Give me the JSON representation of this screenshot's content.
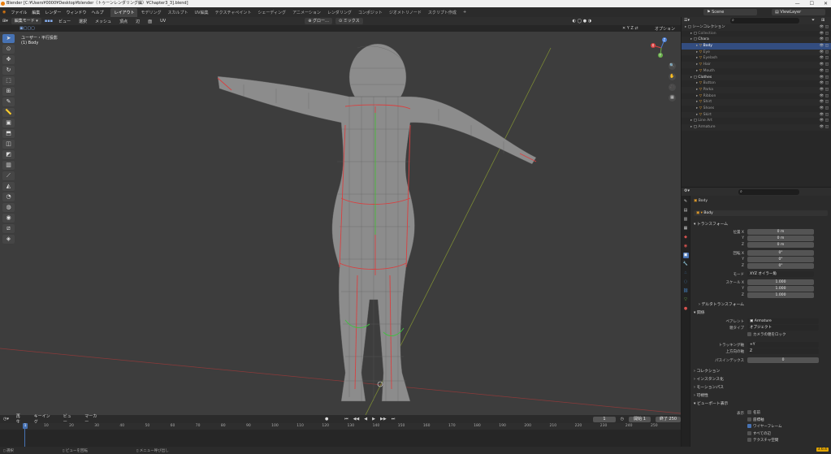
{
  "window": {
    "title": "Blender [C:¥Users¥0000¥Desktop¥blender（トゥーンレンダリング編）¥Chapter3_3].blend]",
    "controls": [
      "—",
      "☐",
      "✕"
    ]
  },
  "menubar": {
    "menus": [
      "ファイル",
      "編集",
      "レンダー",
      "ウィンドウ",
      "ヘルプ"
    ],
    "workspaces": [
      "レイアウト",
      "モデリング",
      "スカルプト",
      "UV編集",
      "テクスチャペイント",
      "シェーディング",
      "アニメーション",
      "レンダリング",
      "コンポジット",
      "ジオメトリノード",
      "スクリプト作成"
    ],
    "active_workspace": "レイアウト",
    "add_tab": "+",
    "scene": "Scene",
    "view_layer": "ViewLayer"
  },
  "viewport_header": {
    "mode": "編集モード",
    "menus": [
      "ビュー",
      "選択",
      "メッシュ",
      "頂点",
      "辺",
      "面",
      "UV"
    ],
    "transform_orientation": "グロー…",
    "snap_mode": "ミックス",
    "options": "オプション"
  },
  "viewport": {
    "view_name": "ユーザー・平行投影",
    "object_name": "(1) Body",
    "tools": [
      "select",
      "cursor",
      "move",
      "rotate",
      "scale",
      "transform",
      "annotate",
      "measure",
      "add-cube",
      "extrude",
      "inset",
      "bevel",
      "loop-cut",
      "knife",
      "poly-build",
      "spin",
      "smooth",
      "shrink",
      "shear",
      "rip"
    ],
    "nav_buttons": [
      "🔍",
      "✋",
      "🎥",
      "▦"
    ],
    "gizmo_axes": [
      "X",
      "Y",
      "Z"
    ]
  },
  "timeline": {
    "menus": [
      "再生",
      "キーイング",
      "ビュー",
      "マーカー"
    ],
    "current_frame": "1",
    "start_label": "開始",
    "start": "1",
    "end_label": "終了",
    "end": "250",
    "ticks": [
      "1",
      "10",
      "20",
      "30",
      "40",
      "50",
      "60",
      "70",
      "80",
      "90",
      "100",
      "110",
      "120",
      "130",
      "140",
      "150",
      "160",
      "170",
      "180",
      "190",
      "200",
      "210",
      "220",
      "230",
      "240",
      "250"
    ],
    "transport": [
      "⏮",
      "◀◀",
      "◀",
      "▶",
      "▶▶",
      "⏭"
    ]
  },
  "statusbar": {
    "items": [
      "選択",
      "ビューを回転",
      "メニュー呼び出し"
    ],
    "version": "3.6.4"
  },
  "outliner": {
    "rows": [
      {
        "label": "シーンコレクション",
        "indent": 0,
        "color": "#cfcfcf"
      },
      {
        "label": "Collection",
        "indent": 1,
        "color": "#8a8a8a"
      },
      {
        "label": "Chara",
        "indent": 1,
        "color": "#e0e0e0"
      },
      {
        "label": "Body",
        "indent": 2,
        "color": "#ffffff",
        "selected": true
      },
      {
        "label": "Eye",
        "indent": 2,
        "color": "#9a9a9a"
      },
      {
        "label": "Eyelash",
        "indent": 2,
        "color": "#9a9a9a"
      },
      {
        "label": "Hair",
        "indent": 2,
        "color": "#9a9a9a"
      },
      {
        "label": "Mouth",
        "indent": 2,
        "color": "#9a9a9a"
      },
      {
        "label": "Clothes",
        "indent": 1,
        "color": "#e0e0e0"
      },
      {
        "label": "Button",
        "indent": 2,
        "color": "#9a9a9a"
      },
      {
        "label": "Parka",
        "indent": 2,
        "color": "#9a9a9a"
      },
      {
        "label": "Ribbon",
        "indent": 2,
        "color": "#9a9a9a"
      },
      {
        "label": "Shirt",
        "indent": 2,
        "color": "#9a9a9a"
      },
      {
        "label": "Shoes",
        "indent": 2,
        "color": "#9a9a9a"
      },
      {
        "label": "Skirt",
        "indent": 2,
        "color": "#9a9a9a"
      },
      {
        "label": "Line Art",
        "indent": 1,
        "color": "#9a9a9a"
      },
      {
        "label": "Armature",
        "indent": 1,
        "color": "#9a9a9a"
      }
    ]
  },
  "properties": {
    "object_name": "Body",
    "data_name": "Body",
    "transform": {
      "header": "トランスフォーム",
      "location_label": "位置 X",
      "location": [
        "0 m",
        "0 m",
        "0 m"
      ],
      "rotation_label": "回転 X",
      "rotation": [
        "0°",
        "0°",
        "0°"
      ],
      "mode_label": "モード",
      "mode": "XYZ オイラー角",
      "scale_label": "スケール X",
      "scale": [
        "1.000",
        "1.000",
        "1.000"
      ],
      "axis_y": "Y",
      "axis_z": "Z"
    },
    "delta_transform": "デルタトランスフォーム",
    "relations": {
      "header": "関係",
      "parent_label": "ペアレント",
      "parent": "Armature",
      "parent_type_label": "親タイプ",
      "parent_type": "オブジェクト",
      "camera_parent_label": "カメラの親をロック",
      "tracking_axis_label": "トラッキング軸",
      "tracking_axis": "+Y",
      "up_axis_label": "上方向の軸",
      "up_axis": "Z",
      "pass_index_label": "パスインデックス",
      "pass_index": "0"
    },
    "collapsed_sections": [
      "コレクション",
      "インスタンス化",
      "モーションパス",
      "可視性"
    ],
    "viewport_display": {
      "header": "ビューポート表示",
      "show_label": "表示",
      "options": [
        {
          "label": "名前",
          "checked": false
        },
        {
          "label": "座標軸",
          "checked": false
        },
        {
          "label": "ワイヤーフレーム",
          "checked": true
        },
        {
          "label": "すべての辺",
          "checked": false
        },
        {
          "label": "テクスチャ空間",
          "checked": false
        }
      ]
    }
  }
}
